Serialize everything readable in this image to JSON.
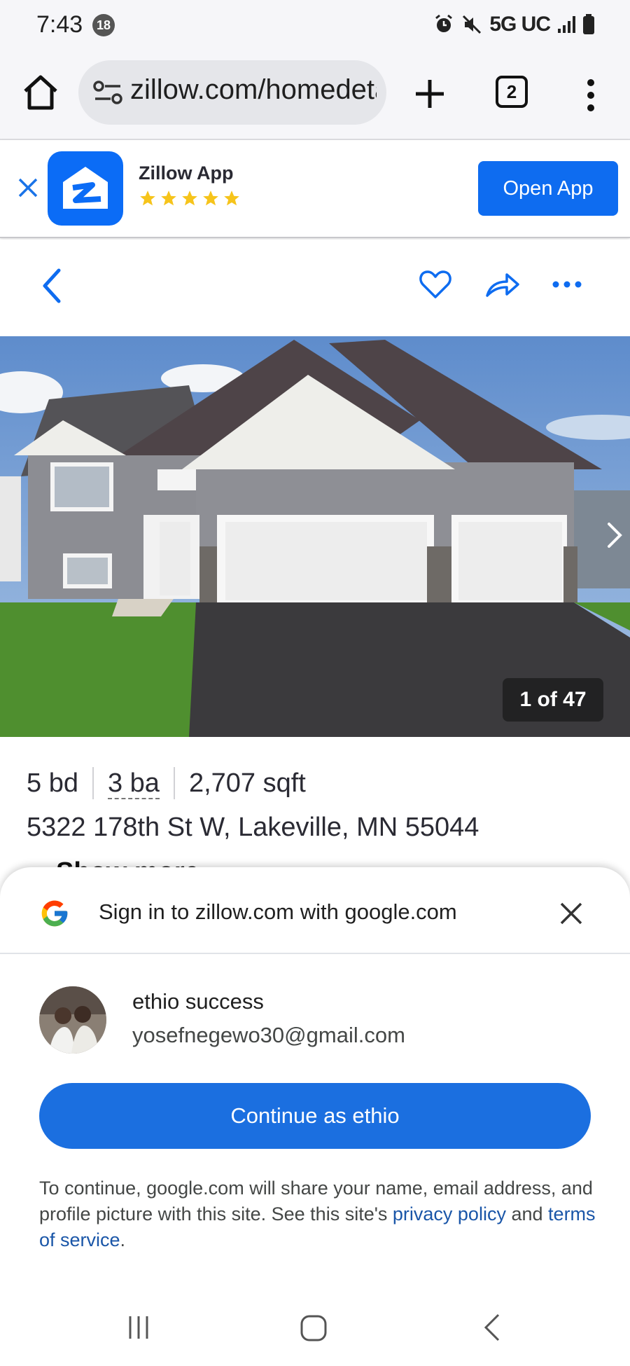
{
  "status_bar": {
    "time": "7:43",
    "notification_count": "18",
    "network": "5G UC",
    "icons": [
      "alarm-icon",
      "mute-icon",
      "signal-icon",
      "battery-icon"
    ]
  },
  "browser": {
    "url": "zillow.com/homedetails",
    "tab_count": "2",
    "icons": [
      "home-icon",
      "site-settings-icon",
      "new-tab-plus-icon",
      "tabs-icon",
      "more-vert-icon"
    ]
  },
  "app_banner": {
    "app_name": "Zillow App",
    "rating_stars": 5,
    "open_button": "Open App",
    "colors": {
      "brand": "#0b6cf6",
      "star": "#f6c41b"
    }
  },
  "listing": {
    "photo_counter": "1 of 47",
    "beds": "5 bd",
    "baths": "3 ba",
    "sqft": "2,707 sqft",
    "address": "5322 178th St W, Lakeville, MN 55044",
    "peek_text": "Show more",
    "icons": [
      "back-chevron-icon",
      "heart-icon",
      "share-icon",
      "more-horiz-icon",
      "next-photo-chevron-icon"
    ],
    "colors": {
      "accent": "#0e6cf0"
    }
  },
  "signin_sheet": {
    "title": "Sign in to zillow.com with google.com",
    "account_name": "ethio success",
    "account_email": "yosefnegewo30@gmail.com",
    "continue_button": "Continue as ethio",
    "disclaimer_text": "To continue, google.com will share your name, email address, and profile picture with this site. See this site's",
    "privacy_link": "privacy policy",
    "and_text": "and",
    "terms_link": "terms of service",
    "period": ".",
    "colors": {
      "button": "#1b6fe0",
      "link": "#1a56a8"
    }
  },
  "system_nav": {
    "icons": [
      "recents-icon",
      "home-circle-icon",
      "back-icon"
    ]
  }
}
